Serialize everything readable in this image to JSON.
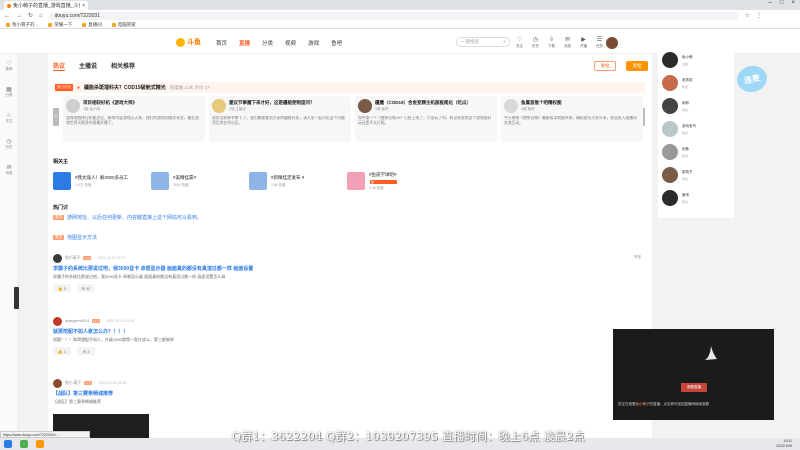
{
  "browser": {
    "tab_title": "兔小萌子的直播_游戏直播_斗鱼直播",
    "url": "douyu.com/7222031",
    "bookmarks": [
      {
        "label": "兔小萌子的..."
      },
      {
        "label": "荣耀一下"
      },
      {
        "label": "直播间"
      },
      {
        "label": "电脑管家"
      }
    ],
    "status_url": "https://www.douyu.com/7222031#..."
  },
  "site": {
    "logo_text": "斗鱼",
    "nav": [
      {
        "label": "首页",
        "active": false
      },
      {
        "label": "直播",
        "active": true
      },
      {
        "label": "分类",
        "active": false
      },
      {
        "label": "视频",
        "active": false
      },
      {
        "label": "游戏",
        "active": false
      },
      {
        "label": "鱼吧",
        "active": false
      }
    ],
    "search_placeholder": "一键搜索",
    "header_icons": [
      {
        "label": "关注",
        "icon": "heart-icon",
        "glyph": "♡"
      },
      {
        "label": "历史",
        "icon": "clock-icon",
        "glyph": "◷"
      },
      {
        "label": "下载",
        "icon": "download-icon",
        "glyph": "⇩"
      },
      {
        "label": "消息",
        "icon": "message-icon",
        "glyph": "✉"
      },
      {
        "label": "开播",
        "icon": "live-icon",
        "glyph": "▶"
      },
      {
        "label": "任务",
        "icon": "task-icon",
        "glyph": "☰"
      }
    ]
  },
  "sidebar": {
    "items": [
      {
        "label": "推荐",
        "icon": "heart-icon",
        "glyph": "♡"
      },
      {
        "label": "分类",
        "icon": "grid-icon",
        "glyph": "▦"
      },
      {
        "label": "关注",
        "icon": "star-icon",
        "glyph": "☆"
      },
      {
        "label": "历史",
        "icon": "history-icon",
        "glyph": "◷"
      },
      {
        "label": "消息",
        "icon": "bell-icon",
        "glyph": "✉"
      }
    ]
  },
  "main": {
    "tabs": [
      {
        "label": "热议",
        "active": true
      },
      {
        "label": "主播说",
        "active": false
      },
      {
        "label": "相关推荐",
        "active": false
      }
    ],
    "btn_outline": "发帖",
    "btn_fill": "发帖",
    "hot": {
      "tag": "热门讨论",
      "title": "疆能杀斑埋科夫？COD19破舱式精光",
      "meta": "热度值 2.2k  讨论 17"
    },
    "cards": [
      {
        "title": "项目相较好机《游戏大师》",
        "sub": "1楼 兔小萌",
        "body": "游戏领跑体位机能点达，新的内容游戏天天来，我们的游戏同频次享受，最近游戏世界天赋多的直播开播了。",
        "color": "#cfcfcf"
      },
      {
        "title": "建议节拳魔下来才好，这是疆能使制度问？",
        "sub": "2楼 主播说",
        "body": "说实话如果节拳下了，我们都能看到大家的疆能好处，请大家一起讨论这个问题然后发在评论区。",
        "color": "#e6c97a"
      },
      {
        "title": "疆魔（COD19）合金变精主机面板尾化（吃瓜）",
        "sub": "3楼 鱼吧",
        "body": "如今第一个《使命召唤19》已经上线了，大家玩了吗，有没有觉得这个游戏很好玩还是不太行呢。",
        "color": "#7a5b48"
      },
      {
        "title": "鱼属首推个吧精权图",
        "sub": "4楼 鱼吧",
        "body": "今天带来《使命召唤》最新版本地图评测，精权图与大家分享，欢迎进入直播间交流互动。",
        "color": "#d8d8d8"
      }
    ],
    "related_label": "相关主",
    "related": [
      {
        "name": "#我太强人！解2000多员工",
        "meta": "1.0万 热度",
        "badge": "",
        "color": "#2d7be5"
      },
      {
        "name": "#美精挂靠#",
        "meta": "3093 热度",
        "badge": "",
        "color": "#8fb4e6"
      },
      {
        "name": "#新精挂定发布 #",
        "meta": "2.8k 热度",
        "badge": "",
        "color": "#8fb4e6"
      },
      {
        "name": "#鱼皮学球吧#",
        "meta": "2.4k 热度",
        "badge": "热",
        "color": "#f2a0b5"
      }
    ],
    "notice_label": "热门讨",
    "notice_1_tag": "置顶",
    "notice_1_text": "游网地址、以后任何更新、内容都直接上这个网站可以看到。",
    "notice_2_tag": "置顶",
    "notice_2_text": "地图显示方法"
  },
  "posts": [
    {
      "name": "兔小萌子",
      "lvl": "Lv.6",
      "time": "2022-10-19 12:07",
      "title": "求膜子的系统比那说过吧，我3090显卡 卓感显示器 画面真的都没有真渲过都一样 画面设置",
      "body": "求膜子的系统比那说过吧，我3090显卡 卓感显示器 画面真的都没有真渲过都一样 画面设置怎么调",
      "likes": "5",
      "comments": "32",
      "report": "举报",
      "avatar": "#3a3a3a"
    },
    {
      "name": "dyangem0014",
      "lvl": "Lv.4",
      "time": "2022-10-19 11:58",
      "title": "就那挖配不如人家怎么办？！！！",
      "body": "如题！！！和渴望配不如人，升级1500就得一直在战斗，第三都装修",
      "likes": "1",
      "comments": "3",
      "report": "",
      "avatar": "#c0392b"
    },
    {
      "name": "兔小 萌子",
      "lvl": "Lv.6",
      "time": "2022-10-18 21:30",
      "title": "【战队】第三赛季畅城推荐",
      "body": "【战区】第三赛季畅城推荐",
      "likes": "",
      "comments": "",
      "report": "",
      "avatar": "#8a4b2a"
    }
  ],
  "right_users": [
    {
      "name": "兔小萌",
      "sub": "主播",
      "color": "#2b2b2b"
    },
    {
      "name": "老男孩",
      "sub": "粉丝",
      "color": "#c66b4c"
    },
    {
      "name": "雨林",
      "sub": "粉丝",
      "color": "#444"
    },
    {
      "name": "游戏老鸟",
      "sub": "粉丝",
      "color": "#b9c7c9"
    },
    {
      "name": "闲鱼",
      "sub": "粉丝",
      "color": "#999"
    },
    {
      "name": "菜狗子",
      "sub": "粉丝",
      "color": "#7a5b48"
    },
    {
      "name": "鱼吧",
      "sub": "粉丝",
      "color": "#2b2b2b"
    }
  ],
  "float_badge": "连麦",
  "player": {
    "button": "观看直播",
    "text_prefix": "您正在观看",
    "text_highlight": "兔小萌子",
    "text_suffix": "的直播，点击即可返回直播间继续观看"
  },
  "marquee": "Q群1：3622204 Q群2：1039207395  直播时间：晚上6点 凌晨2点",
  "tray": {
    "time": "19:11",
    "date": "2022/10/5"
  }
}
